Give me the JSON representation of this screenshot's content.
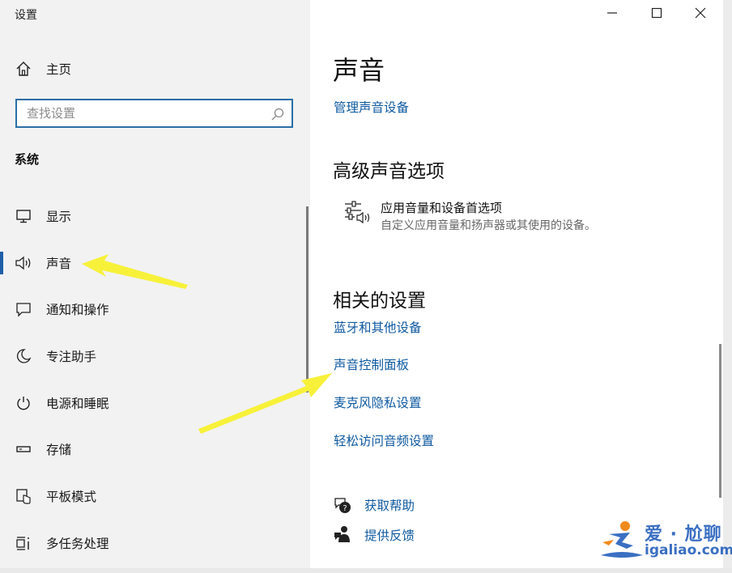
{
  "window": {
    "title": "设置",
    "minimize_icon": "minimize-icon",
    "maximize_icon": "maximize-icon",
    "close_icon": "close-icon"
  },
  "sidebar": {
    "home": {
      "label": "主页",
      "icon": "home-icon"
    },
    "search": {
      "placeholder": "查找设置",
      "value": "",
      "icon": "search-icon"
    },
    "section": "系统",
    "items": [
      {
        "label": "显示",
        "icon": "monitor-icon",
        "active": false
      },
      {
        "label": "声音",
        "icon": "speaker-icon",
        "active": true
      },
      {
        "label": "通知和操作",
        "icon": "notification-icon",
        "active": false
      },
      {
        "label": "专注助手",
        "icon": "moon-icon",
        "active": false
      },
      {
        "label": "电源和睡眠",
        "icon": "power-icon",
        "active": false
      },
      {
        "label": "存储",
        "icon": "storage-icon",
        "active": false
      },
      {
        "label": "平板模式",
        "icon": "tablet-mode-icon",
        "active": false
      },
      {
        "label": "多任务处理",
        "icon": "multitasking-icon",
        "active": false
      }
    ]
  },
  "main": {
    "title": "声音",
    "manage_link": "管理声音设备",
    "advanced": {
      "heading": "高级声音选项",
      "option_title": "应用音量和设备首选项",
      "option_desc": "自定义应用音量和扬声器或其使用的设备。",
      "option_icon": "volume-mixer-icon"
    },
    "related": {
      "heading": "相关的设置",
      "links": [
        "蓝牙和其他设备",
        "声音控制面板",
        "麦克风隐私设置",
        "轻松访问音频设置"
      ]
    },
    "help": {
      "label": "获取帮助",
      "icon": "help-icon"
    },
    "feedback": {
      "label": "提供反馈",
      "icon": "feedback-icon"
    }
  },
  "watermark": {
    "text": "爱 · 尬聊",
    "domain": "igaliao.com"
  },
  "colors": {
    "accent": "#1f5ea8",
    "link": "#0f5aa0",
    "sidebar_bg": "#f2f2f2",
    "annotation_arrow": "#f7f13a",
    "watermark": "#3a6fc2"
  }
}
